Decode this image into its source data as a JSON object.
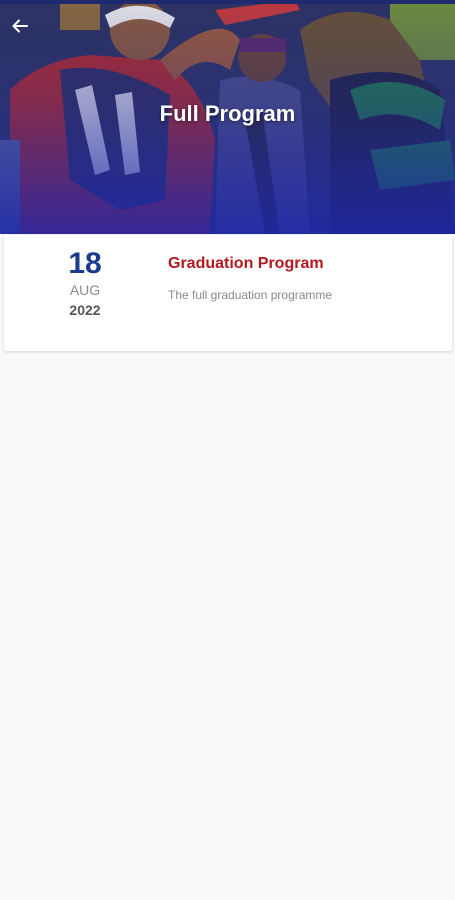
{
  "header": {
    "title": "Full Program",
    "back_icon": "arrow-left-icon"
  },
  "events": [
    {
      "day": "18",
      "month": "AUG",
      "year": "2022",
      "title": "Graduation Program",
      "description": "The full graduation programme"
    }
  ],
  "colors": {
    "date_day": "#1a3c8f",
    "event_title": "#b3191f",
    "header_overlay": "#1e28aa",
    "background": "#f9f9f9"
  }
}
